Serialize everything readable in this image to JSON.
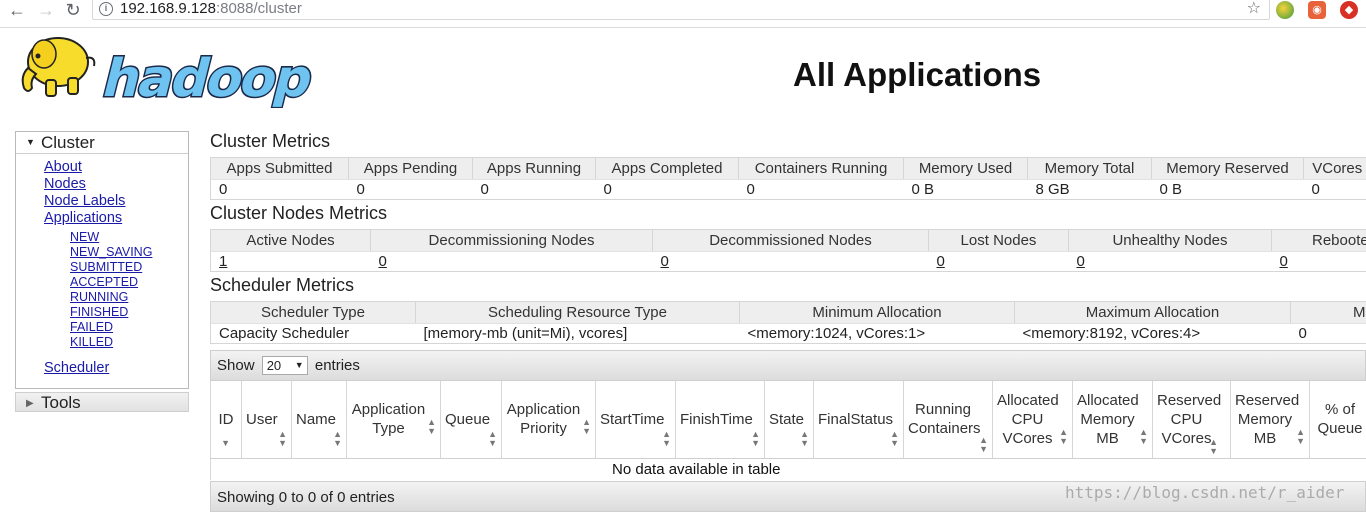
{
  "browser": {
    "url_host": "192.168.9.128",
    "url_rest": ":8088/cluster"
  },
  "logo_text": "hadoop",
  "page_title": "All Applications",
  "nav": {
    "cluster_label": "Cluster",
    "links": [
      "About",
      "Nodes",
      "Node Labels",
      "Applications"
    ],
    "app_states": [
      "NEW",
      "NEW_SAVING",
      "SUBMITTED",
      "ACCEPTED",
      "RUNNING",
      "FINISHED",
      "FAILED",
      "KILLED"
    ],
    "scheduler_label": "Scheduler",
    "tools_label": "Tools"
  },
  "cluster_metrics": {
    "title": "Cluster Metrics",
    "headers": [
      "Apps Submitted",
      "Apps Pending",
      "Apps Running",
      "Apps Completed",
      "Containers Running",
      "Memory Used",
      "Memory Total",
      "Memory Reserved",
      "VCores"
    ],
    "values": [
      "0",
      "0",
      "0",
      "0",
      "0",
      "0 B",
      "8 GB",
      "0 B",
      "0"
    ]
  },
  "nodes_metrics": {
    "title": "Cluster Nodes Metrics",
    "headers": [
      "Active Nodes",
      "Decommissioning Nodes",
      "Decommissioned Nodes",
      "Lost Nodes",
      "Unhealthy Nodes",
      "Rebooted"
    ],
    "values": [
      "1",
      "0",
      "0",
      "0",
      "0",
      "0"
    ]
  },
  "scheduler_metrics": {
    "title": "Scheduler Metrics",
    "headers": [
      "Scheduler Type",
      "Scheduling Resource Type",
      "Minimum Allocation",
      "Maximum Allocation",
      "M"
    ],
    "values": [
      "Capacity Scheduler",
      "[memory-mb (unit=Mi), vcores]",
      "<memory:1024, vCores:1>",
      "<memory:8192, vCores:4>",
      "0"
    ]
  },
  "apps_table": {
    "show_label": "Show",
    "page_size": "20",
    "entries_label": "entries",
    "columns": [
      "ID",
      "User",
      "Name",
      "Application Type",
      "Queue",
      "Application Priority",
      "StartTime",
      "FinishTime",
      "State",
      "FinalStatus",
      "Running Containers",
      "Allocated CPU VCores",
      "Allocated Memory MB",
      "Reserved CPU VCores",
      "Reserved Memory MB",
      "% of Queue"
    ],
    "empty_message": "No data available in table",
    "info": "Showing 0 to 0 of 0 entries"
  },
  "watermark": "https://blog.csdn.net/r_aider"
}
